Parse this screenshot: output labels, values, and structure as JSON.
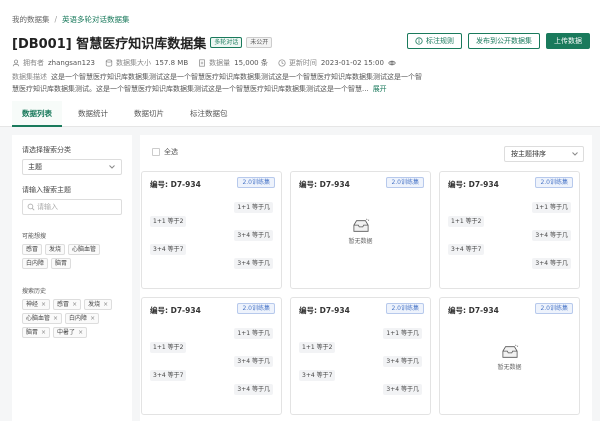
{
  "breadcrumb": {
    "root": "我的数据集",
    "sep": "/",
    "current": "英语多轮对话数据集"
  },
  "header": {
    "title": "[DB001] 智慧医疗知识库数据集",
    "tag1": "多轮对话",
    "tag2": "未公开",
    "btn_rules": "标注规则",
    "btn_publish": "发布到公开数据集",
    "btn_upload": "上传数据"
  },
  "meta": {
    "owner_label": "拥有者",
    "owner": "zhangsan123",
    "size_label": "数据集大小",
    "size": "157.8 MB",
    "count_label": "数据量",
    "count": "15,000 条",
    "updated_label": "更新时间",
    "updated": "2023-01-02 15:00"
  },
  "description": {
    "label": "数据集描述",
    "text": "这是一个智慧医疗知识库数据集测试这是一个智慧医疗知识库数据集测试这是一个智慧医疗知识库数据集测试这是一个智慧医疗知识库数据集测试。这是一个智慧医疗知识库数据集测试这是一个智慧医疗知识库数据集测试这是一个智慧...",
    "more": "展开"
  },
  "tabs": [
    "数据列表",
    "数据统计",
    "数据切片",
    "标注数据包"
  ],
  "sidebar": {
    "category_label": "请选择搜索分类",
    "category_value": "主题",
    "topic_label": "请输入搜索主题",
    "topic_placeholder": "请输入",
    "suggest_label": "可能想搜",
    "suggest": [
      "感冒",
      "发烧",
      "心脑血管",
      "白内障",
      "脑胃"
    ],
    "history_label": "搜索历史",
    "history": [
      "神经",
      "感冒",
      "发烧",
      "心脑血管",
      "白内障",
      "脑胃",
      "中暑了"
    ]
  },
  "toolbar": {
    "select_all": "全选",
    "sort": "按主题排序"
  },
  "cards": {
    "id": "编号: D7-934",
    "badge": "2.0训练集",
    "q1": "1+1 等于几",
    "a1": "1+1 等于2",
    "q2": "3+4 等于几",
    "a2": "3+4 等于7",
    "empty": "暂无数据"
  },
  "colors": {
    "accent": "#1a7a5c",
    "badge": "#4a76c7"
  }
}
